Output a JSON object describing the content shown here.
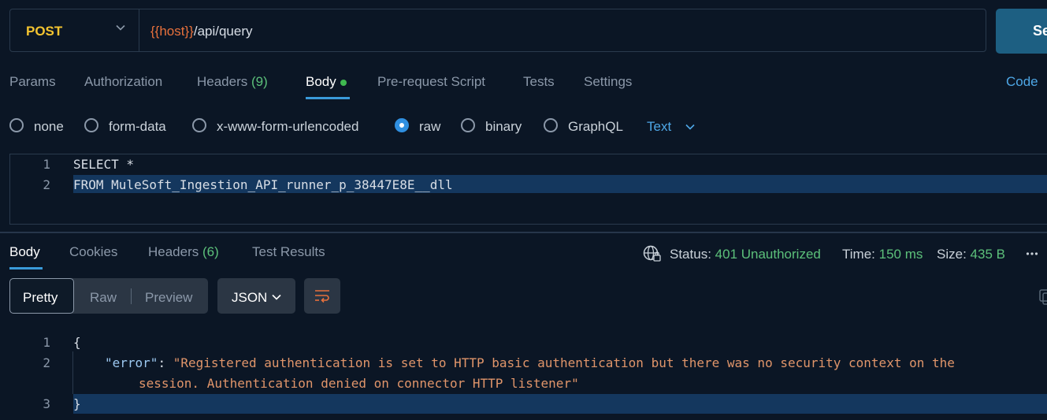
{
  "request": {
    "method": "POST",
    "url_var": "{{host}}",
    "url_path": "/api/query",
    "send_label": "Se"
  },
  "request_tabs": {
    "params": "Params",
    "authorization": "Authorization",
    "headers": "Headers",
    "headers_count": "(9)",
    "body": "Body",
    "prerequest": "Pre-request Script",
    "tests": "Tests",
    "settings": "Settings",
    "code": "Code"
  },
  "body_types": {
    "none": "none",
    "form_data": "form-data",
    "urlencoded": "x-www-form-urlencoded",
    "raw": "raw",
    "binary": "binary",
    "graphql": "GraphQL",
    "selected": "raw",
    "text_format": "Text"
  },
  "editor": {
    "lines": [
      {
        "n": "1",
        "text": "SELECT *"
      },
      {
        "n": "2",
        "text": "FROM MuleSoft_Ingestion_API_runner_p_38447E8E__dll"
      }
    ]
  },
  "response_tabs": {
    "body": "Body",
    "cookies": "Cookies",
    "headers": "Headers",
    "headers_count": "(6)",
    "test_results": "Test Results"
  },
  "response_meta": {
    "status_label": "Status:",
    "status_value": "401 Unauthorized",
    "time_label": "Time:",
    "time_value": "150 ms",
    "size_label": "Size:",
    "size_value": "435 B"
  },
  "response_toolbar": {
    "pretty": "Pretty",
    "raw": "Raw",
    "preview": "Preview",
    "format": "JSON"
  },
  "response_body": {
    "line_numbers": [
      "1",
      "2",
      "3"
    ],
    "open_brace": "{",
    "key": "\"error\"",
    "colon": ": ",
    "value_line1": "\"Registered authentication is set to HTTP basic authentication but there was no security context on the",
    "value_line2": "session. Authentication denied on connector HTTP listener\"",
    "close_brace": "}"
  },
  "colors": {
    "background": "#0b1625",
    "method": "#f4c430",
    "url_variable": "#e8713c",
    "accent": "#3a9ad9",
    "send_button": "#1d5f82",
    "status_ok_green": "#5cc07a",
    "json_string": "#e0956a"
  }
}
